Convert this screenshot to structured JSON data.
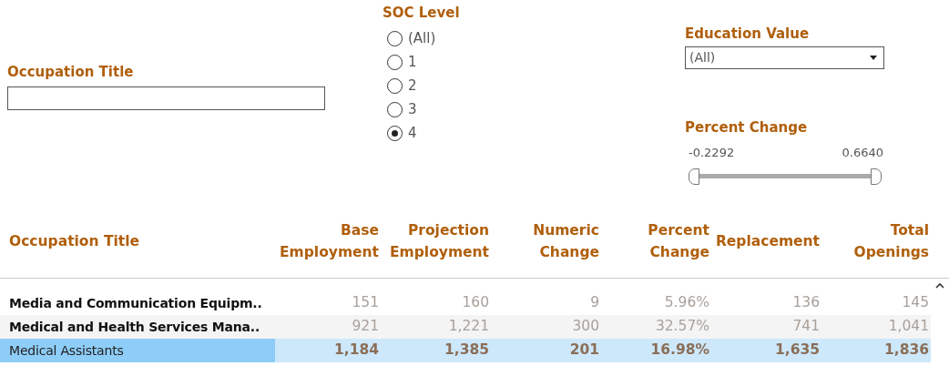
{
  "filters": {
    "occupation_title": {
      "label": "Occupation Title"
    },
    "soc_level": {
      "label": "SOC Level",
      "options": [
        {
          "label": "(All)",
          "selected": false
        },
        {
          "label": "1",
          "selected": false
        },
        {
          "label": "2",
          "selected": false
        },
        {
          "label": "3",
          "selected": false
        },
        {
          "label": "4",
          "selected": true
        }
      ]
    },
    "education_value": {
      "label": "Education Value",
      "value": "(All)"
    },
    "percent_change": {
      "label": "Percent Change",
      "min": "-0.2292",
      "max": "0.6640",
      "handles": [
        {
          "level": 0
        },
        {
          "level": 1
        }
      ]
    }
  },
  "table": {
    "columns": [
      "Occupation Title",
      "Base Employment",
      "Projection Employment",
      "Numeric Change",
      "Percent Change",
      "Replacement",
      "Total Openings"
    ],
    "rows": [
      {
        "cells": [
          "Media and Communication Equipm..",
          "151",
          "160",
          "9",
          "5.96%",
          "136",
          "145"
        ],
        "selected": false
      },
      {
        "cells": [
          "Medical and Health Services Mana..",
          "921",
          "1,221",
          "300",
          "32.57%",
          "741",
          "1,041"
        ],
        "selected": false
      },
      {
        "cells": [
          "Medical Assistants",
          "1,184",
          "1,385",
          "201",
          "16.98%",
          "1,635",
          "1,836"
        ],
        "selected": true
      }
    ]
  }
}
